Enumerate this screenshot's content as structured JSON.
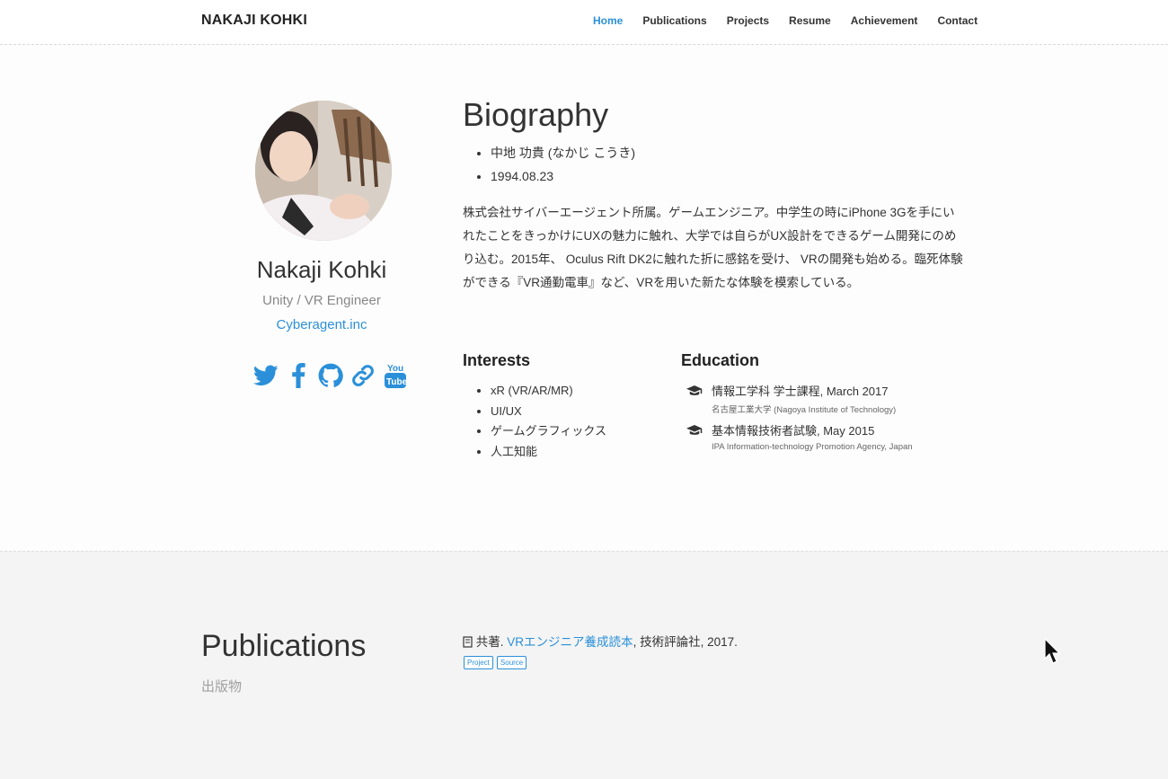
{
  "navbar": {
    "brand": "NAKAJI KOHKI",
    "items": [
      "Home",
      "Publications",
      "Projects",
      "Resume",
      "Achievement",
      "Contact"
    ],
    "active": "Home"
  },
  "profile": {
    "name": "Nakaji Kohki",
    "role": "Unity / VR Engineer",
    "org": "Cyberagent.inc",
    "social_icons": [
      "twitter-icon",
      "facebook-icon",
      "github-icon",
      "link-icon",
      "youtube-icon"
    ]
  },
  "biography": {
    "title": "Biography",
    "facts": [
      "中地 功貴 (なかじ こうき)",
      "1994.08.23"
    ],
    "text": "株式会社サイバーエージェント所属。ゲームエンジニア。中学生の時にiPhone 3Gを手にいれたことをきっかけにUXの魅力に触れ、大学では自らがUX設計をできるゲーム開発にのめり込む。2015年、 Oculus Rift DK2に触れた折に感銘を受け、 VRの開発も始める。臨死体験ができる『VR通勤電車』など、VRを用いた新たな体験を模索している。"
  },
  "interests": {
    "title": "Interests",
    "items": [
      "xR (VR/AR/MR)",
      "UI/UX",
      "ゲームグラフィックス",
      "人工知能"
    ]
  },
  "education": {
    "title": "Education",
    "items": [
      {
        "degree": "情報工学科 学士課程, March 2017",
        "school": "名古屋工業大学 (Nagoya Institute of Technology)"
      },
      {
        "degree": "基本情報技術者試験, May 2015",
        "school": "IPA Information-technology Promotion Agency, Japan"
      }
    ]
  },
  "publications": {
    "title": "Publications",
    "subtitle": "出版物",
    "entry_prefix": "共著.",
    "entry_link": "VRエンジニア養成読本",
    "entry_suffix": ", 技術評論社, 2017.",
    "buttons": [
      "Project",
      "Source"
    ]
  },
  "colors": {
    "accent": "#2b90d9",
    "text": "#333333",
    "muted": "#888888"
  }
}
